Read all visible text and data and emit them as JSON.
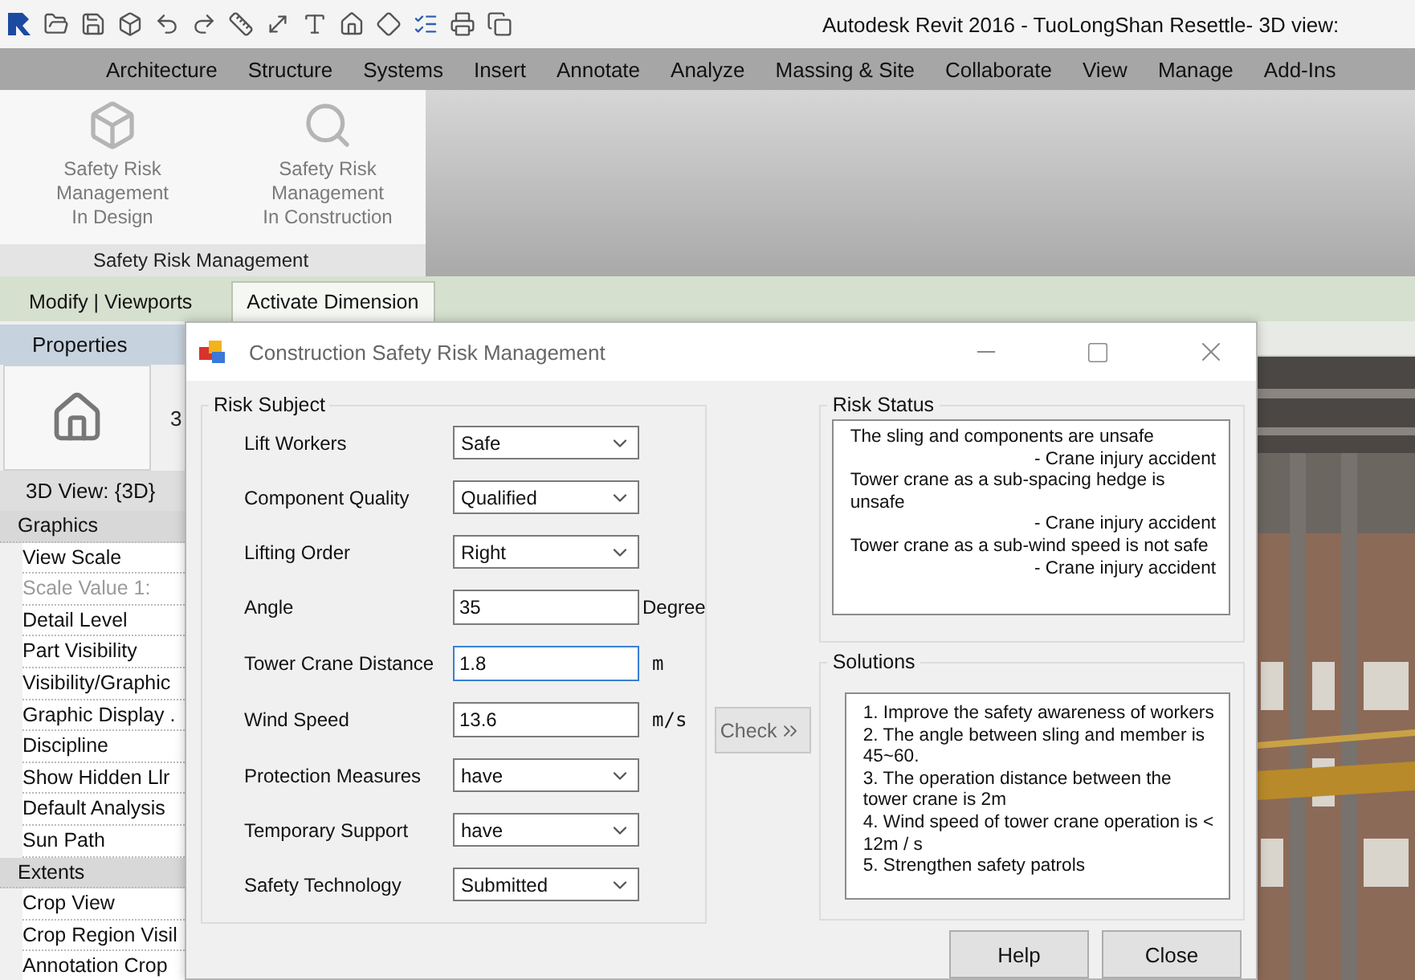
{
  "window": {
    "title": "Autodesk Revit 2016 - TuoLongShan Resettle- 3D view:"
  },
  "ribbon_tabs": [
    {
      "label": "Architecture"
    },
    {
      "label": "Structure"
    },
    {
      "label": "Systems"
    },
    {
      "label": "Insert"
    },
    {
      "label": "Annotate"
    },
    {
      "label": "Analyze"
    },
    {
      "label": "Massing & Site"
    },
    {
      "label": "Collaborate"
    },
    {
      "label": "View"
    },
    {
      "label": "Manage"
    },
    {
      "label": "Add-Ins"
    }
  ],
  "ribbon_panel": {
    "title": "Safety Risk Management",
    "buttons": [
      {
        "kind": "design",
        "lines": [
          "Safety Risk",
          "Management",
          "In Design"
        ]
      },
      {
        "kind": "construction",
        "lines": [
          "Safety Risk",
          "Management",
          "In Construction"
        ]
      }
    ]
  },
  "context_tabs": [
    {
      "label": "Modify | Viewports",
      "selected": false
    },
    {
      "label": "Activate Dimension",
      "selected": true
    }
  ],
  "properties": {
    "title": "Properties",
    "type_text": "3",
    "view_label": "3D View: {3D}",
    "rows": [
      {
        "kind": "category",
        "label": "Graphics"
      },
      {
        "kind": "param",
        "label": "View Scale",
        "disabled": false
      },
      {
        "kind": "param",
        "label": "Scale Value  1:",
        "disabled": true
      },
      {
        "kind": "param",
        "label": "Detail Level",
        "disabled": false
      },
      {
        "kind": "param",
        "label": "Part Visibility",
        "disabled": false
      },
      {
        "kind": "param",
        "label": "Visibility/Graphic",
        "disabled": false
      },
      {
        "kind": "param",
        "label": "Graphic Display .",
        "disabled": false
      },
      {
        "kind": "param",
        "label": "Discipline",
        "disabled": false
      },
      {
        "kind": "param",
        "label": "Show Hidden Llr",
        "disabled": false
      },
      {
        "kind": "param",
        "label": "Default Analysis",
        "disabled": false
      },
      {
        "kind": "param",
        "label": "Sun Path",
        "disabled": false
      },
      {
        "kind": "category",
        "label": "Extents"
      },
      {
        "kind": "param",
        "label": "Crop View",
        "disabled": false
      },
      {
        "kind": "param",
        "label": "Crop Region Visil",
        "disabled": false
      },
      {
        "kind": "param",
        "label": "Annotation Crop",
        "disabled": false
      }
    ]
  },
  "dialog": {
    "title": "Construction Safety Risk Management",
    "risk_subject": {
      "title": "Risk Subject",
      "fields": [
        {
          "label": "Lift Workers",
          "kind": "select",
          "value": "Safe"
        },
        {
          "label": "Component Quality",
          "kind": "select",
          "value": "Qualified"
        },
        {
          "label": "Lifting Order",
          "kind": "select",
          "value": "Right"
        },
        {
          "label": "Angle",
          "kind": "input",
          "value": "35",
          "unit": "Degree",
          "focused": false
        },
        {
          "label": "Tower Crane Distance",
          "kind": "input",
          "value": "1.8",
          "unit": "m",
          "focused": true
        },
        {
          "label": "Wind Speed",
          "kind": "input",
          "value": "13.6",
          "unit": "m/s",
          "focused": false
        },
        {
          "label": "Protection Measures",
          "kind": "select",
          "value": "have"
        },
        {
          "label": "Temporary Support",
          "kind": "select",
          "value": "have"
        },
        {
          "label": "Safety Technology",
          "kind": "select",
          "value": "Submitted"
        }
      ]
    },
    "check_button": "Check",
    "risk_status": {
      "title": "Risk Status",
      "lines": [
        {
          "kind": "cause",
          "text": "The sling and components are unsafe"
        },
        {
          "kind": "consequence",
          "text": "- Crane injury accident"
        },
        {
          "kind": "cause",
          "text": "Tower crane as a sub-spacing hedge is unsafe"
        },
        {
          "kind": "consequence",
          "text": "- Crane injury accident"
        },
        {
          "kind": "cause",
          "text": "Tower crane as a sub-wind speed is not safe"
        },
        {
          "kind": "consequence",
          "text": "- Crane injury accident"
        }
      ]
    },
    "solutions": {
      "title": "Solutions",
      "items": [
        "1. Improve the safety awareness of workers",
        "2. The angle between sling and member is 45~60.",
        "3. The operation distance between the tower crane is 2m",
        "4. Wind speed of tower crane operation is < 12m / s",
        "5. Strengthen safety patrols"
      ]
    },
    "buttons": [
      "Help",
      "Close"
    ]
  }
}
